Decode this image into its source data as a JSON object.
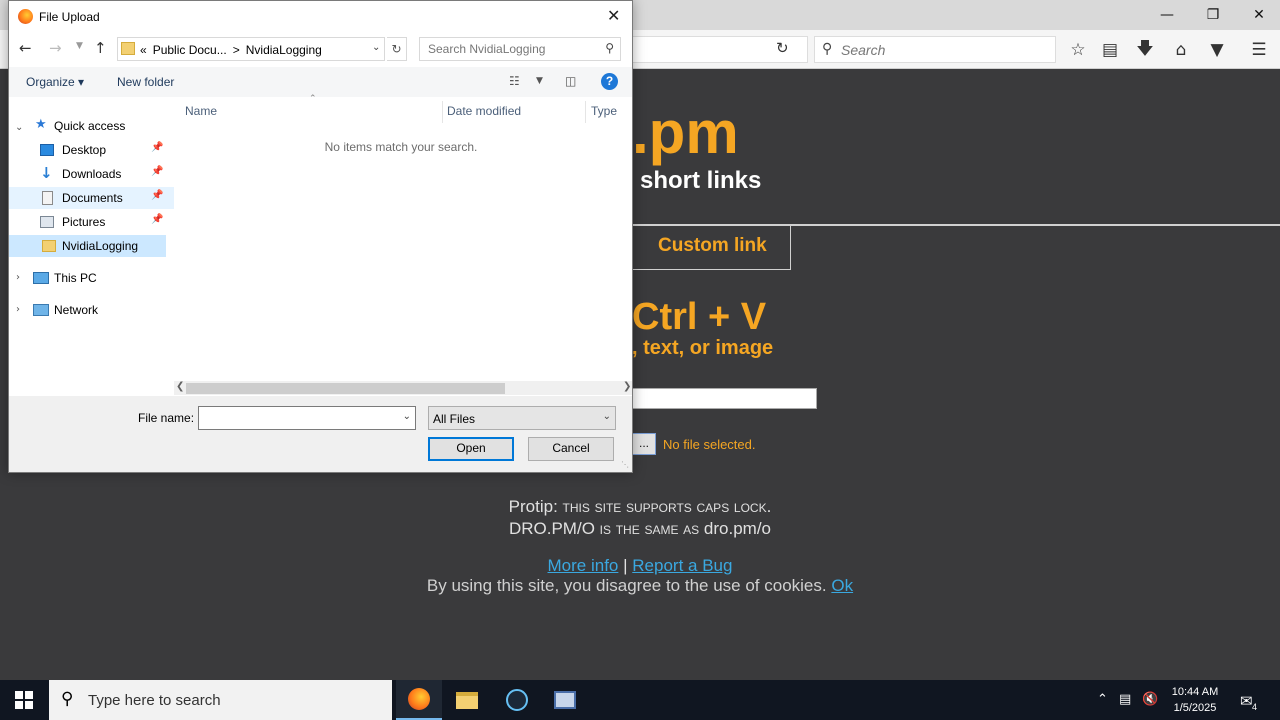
{
  "browser": {
    "web_search_placeholder": "Search",
    "window_controls": [
      "minimize-icon",
      "restore-icon",
      "close-icon"
    ],
    "toolbar_icons": [
      "star-icon",
      "reading-list-icon",
      "download-icon",
      "home-icon",
      "pocket-icon",
      "menu-icon"
    ]
  },
  "page": {
    "brand_suffix": ".pm",
    "tagline": "short links",
    "tab_custom_link": "Custom link",
    "paste_hint": "Ctrl + V",
    "paste_sub": ", text, or image",
    "browse_button": "...",
    "no_file": "No file selected.",
    "protip_label": "Protip:",
    "protip_line1": "this site supports caps lock.",
    "protip_line2_a": "DRO.PM/O",
    "protip_line2_b": "is the same as",
    "protip_line2_c": "dro.pm/o",
    "more_info": "More info",
    "separator": "|",
    "report_bug": "Report a Bug",
    "cookie_text": "By using this site, you disagree to the use of cookies.",
    "cookie_ok": "Ok",
    "colors": {
      "accent": "#f5a623",
      "background": "#3a3a3c",
      "link": "#3aa8e0"
    }
  },
  "dialog": {
    "title": "File Upload",
    "breadcrumb": [
      "«",
      "Public Docu...",
      ">",
      "NvidiaLogging"
    ],
    "search_placeholder": "Search NvidiaLogging",
    "organize": "Organize ▾",
    "new_folder": "New folder",
    "help": "?",
    "nav": {
      "quick_access": "Quick access",
      "items": [
        {
          "label": "Desktop",
          "icon": "desktop-icon",
          "pinned": true
        },
        {
          "label": "Downloads",
          "icon": "downloads-icon",
          "pinned": true
        },
        {
          "label": "Documents",
          "icon": "documents-icon",
          "pinned": true
        },
        {
          "label": "Pictures",
          "icon": "pictures-icon",
          "pinned": true
        },
        {
          "label": "NvidiaLogging",
          "icon": "folder-icon",
          "pinned": false
        }
      ],
      "this_pc": "This PC",
      "network": "Network"
    },
    "columns": [
      "Name",
      "Date modified",
      "Type"
    ],
    "empty_message": "No items match your search.",
    "file_name_label": "File name:",
    "file_name_value": "",
    "filter_value": "All Files",
    "open_button": "Open",
    "cancel_button": "Cancel"
  },
  "taskbar": {
    "search_placeholder": "Type here to search",
    "apps": [
      "firefox-icon",
      "file-explorer-icon",
      "steam-icon",
      "network-app-icon"
    ],
    "time": "10:44 AM",
    "date": "1/5/2025",
    "notification_count": "4"
  }
}
